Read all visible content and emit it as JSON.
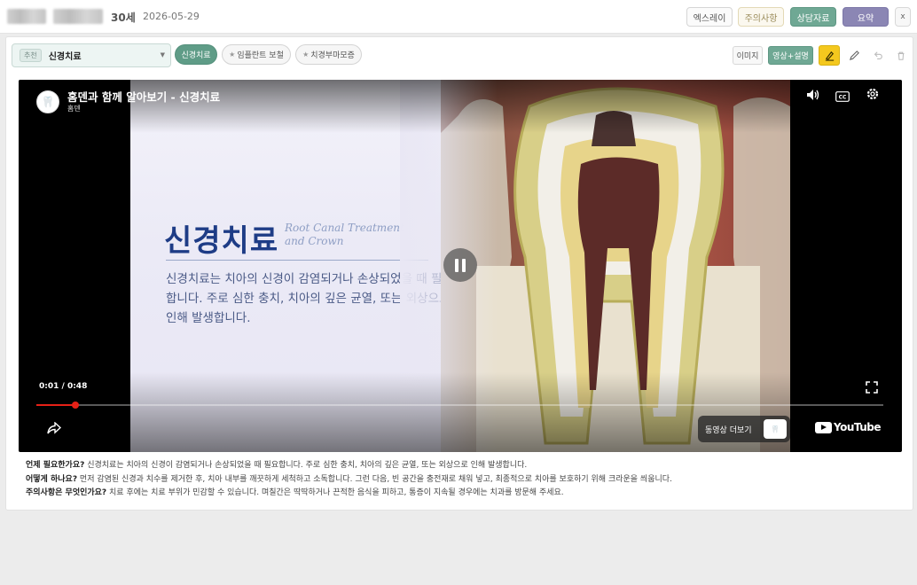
{
  "header": {
    "age": "30세",
    "date": "2026-05-29",
    "buttons": {
      "xray": "엑스레이",
      "caution": "주의사항",
      "consult": "상담자료",
      "summary": "요약",
      "close": "x"
    }
  },
  "toolbar": {
    "select_badge": "추천",
    "select_value": "신경치료",
    "chips": [
      "신경치료",
      "임플란트 보철",
      "치경부마모증"
    ],
    "image_button": "이미지",
    "video_button": "영상+설명"
  },
  "video": {
    "title": "홈덴과 함께 알아보기 - 신경치료",
    "channel": "홈덴",
    "slide_title": "신경치료",
    "slide_subtitle": "Root Canal Treatment and Crown",
    "slide_body": "신경치료는 치아의 신경이 감염되거나 손상되었을 때 필요합니다. 주로 심한 충치, 치아의 깊은 균열, 또는 외상으로 인해 발생합니다.",
    "time": "0:01 / 0:48",
    "progress": 0.046,
    "more_videos": "동영상 더보기",
    "brand": "YouTube"
  },
  "description": {
    "when_q": "언제 필요한가요?",
    "when_a": "신경치료는 치아의 신경이 감염되거나 손상되었을 때 필요합니다. 주로 심한 충치, 치아의 깊은 균열, 또는 외상으로 인해 발생합니다.",
    "how_q": "어떻게 하나요?",
    "how_a": "먼저 감염된 신경과 치수를 제거한 후, 치아 내부를 깨끗하게 세척하고 소독합니다. 그런 다음, 빈 공간을 충전재로 채워 넣고, 최종적으로 치아를 보호하기 위해 크라운을 씌웁니다.",
    "caution_q": "주의사항은 무엇인가요?",
    "caution_a": "치료 후에는 치료 부위가 민감할 수 있습니다. 며칠간은 딱딱하거나 끈적한 음식을 피하고, 통증이 지속될 경우에는 치과를 방문해 주세요."
  }
}
